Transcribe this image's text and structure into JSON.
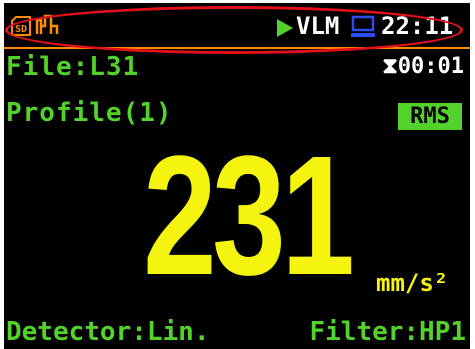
{
  "status_bar": {
    "sd_card_icon": "sd-card-icon",
    "signal_icon": "signal-icon",
    "play_icon": "play-icon",
    "mode": "VLM",
    "pc_icon": "computer-icon",
    "clock": "22:11"
  },
  "file": {
    "label": "File:L31"
  },
  "timer": {
    "value": "00:01",
    "icon": "hourglass-icon"
  },
  "profile": {
    "label": "Profile(1)"
  },
  "badge": {
    "label": "RMS"
  },
  "measurement": {
    "value": "231",
    "unit": "mm/s²"
  },
  "footer": {
    "detector": "Detector:Lin.",
    "filter": "Filter:HP1"
  },
  "colors": {
    "green": "#52d22a",
    "yellow": "#f4f40f",
    "orange": "#ff8c00",
    "annotation_red": "#e2101a"
  }
}
